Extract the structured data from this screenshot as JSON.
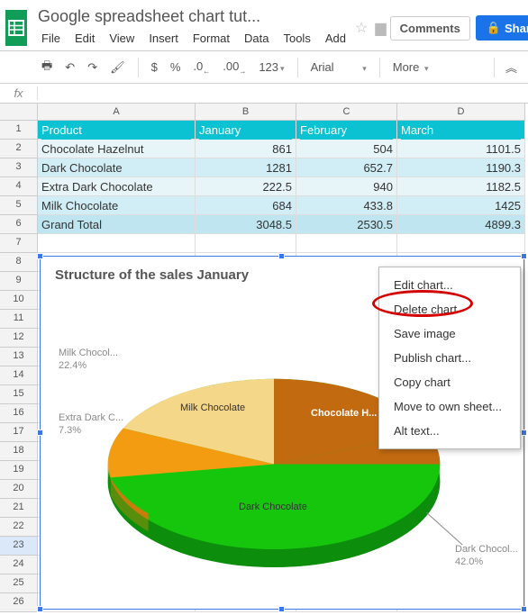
{
  "doc": {
    "title": "Google spreadsheet chart tut..."
  },
  "menus": [
    "File",
    "Edit",
    "View",
    "Insert",
    "Format",
    "Data",
    "Tools"
  ],
  "menu_add": "Add",
  "buttons": {
    "comments": "Comments",
    "share": "Share"
  },
  "toolbar": {
    "dollar": "$",
    "percent": "%",
    "dec_dec": ".0",
    "dec_inc": ".00",
    "fmt123": "123",
    "font": "Arial",
    "more": "More"
  },
  "fx": {
    "label": "fx"
  },
  "columns": [
    "A",
    "B",
    "C",
    "D"
  ],
  "rows": [
    "1",
    "2",
    "3",
    "4",
    "5",
    "6",
    "7",
    "8",
    "9",
    "10",
    "11",
    "12",
    "13",
    "14",
    "15",
    "16",
    "17",
    "18",
    "19",
    "20",
    "21",
    "22",
    "23",
    "24",
    "25",
    "26"
  ],
  "table": {
    "headers": [
      "Product",
      "January",
      "February",
      "March"
    ],
    "data": [
      [
        "Chocolate Hazelnut",
        "861",
        "504",
        "1101.5"
      ],
      [
        "Dark Chocolate",
        "1281",
        "652.7",
        "1190.3"
      ],
      [
        "Extra Dark Chocolate",
        "222.5",
        "940",
        "1182.5"
      ],
      [
        "Milk Chocolate",
        "684",
        "433.8",
        "1425"
      ]
    ],
    "total": [
      "Grand Total",
      "3048.5",
      "2530.5",
      "4899.3"
    ]
  },
  "chart_data": {
    "type": "pie",
    "title": "Structure of the sales January",
    "categories": [
      "Chocolate Hazelnut",
      "Dark Chocolate",
      "Extra Dark Chocolate",
      "Milk Chocolate"
    ],
    "values": [
      861,
      1281,
      222.5,
      684
    ],
    "percents": [
      28.2,
      42.0,
      7.3,
      22.4
    ],
    "labels": {
      "milk": "Milk Chocol...",
      "milk_pct": "22.4%",
      "extra": "Extra Dark C...",
      "extra_pct": "7.3%",
      "dark": "Dark Chocol...",
      "dark_pct": "42.0%",
      "inner_milk": "Milk Chocolate",
      "inner_choc": "Chocolate H...",
      "inner_dark": "Dark Chocolate"
    }
  },
  "context_menu": {
    "items": [
      "Edit chart...",
      "Delete chart",
      "Save image",
      "Publish chart...",
      "Copy chart",
      "Move to own sheet...",
      "Alt text..."
    ]
  }
}
